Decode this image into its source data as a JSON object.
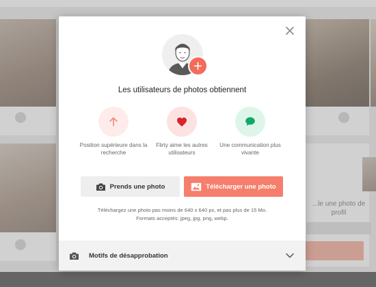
{
  "background": {
    "top_tabs": [
      "...",
      "..."
    ],
    "promo_title": "...le une photo de profil"
  },
  "modal": {
    "title": "Les utilisateurs de photos obtiennent",
    "benefits": [
      {
        "icon": "arrow-up-icon",
        "label": "Position supérieure dans la recherche",
        "bg": "#fdecea",
        "color": "#f28b78"
      },
      {
        "icon": "heart-icon",
        "label": "Flirty aime les autres utilisateurs",
        "bg": "#fde2e2",
        "color": "#d9232d"
      },
      {
        "icon": "chat-bubble-icon",
        "label": "Une communication plus vivante",
        "bg": "#def6ea",
        "color": "#13a867"
      }
    ],
    "take_photo_label": "Prends une photo",
    "upload_photo_label": "Télécharger une photo",
    "note_line1": "Téléchargez une photo pas moins de 640 x 640 px, et pas plus de 15 Mo.",
    "note_line2": "Formats acceptés: jpeg, jpg, png, webp.",
    "footer_label": "Motifs de désapprobation"
  },
  "colors": {
    "accent": "#f57f6c",
    "add_button": "#f26b5b"
  }
}
